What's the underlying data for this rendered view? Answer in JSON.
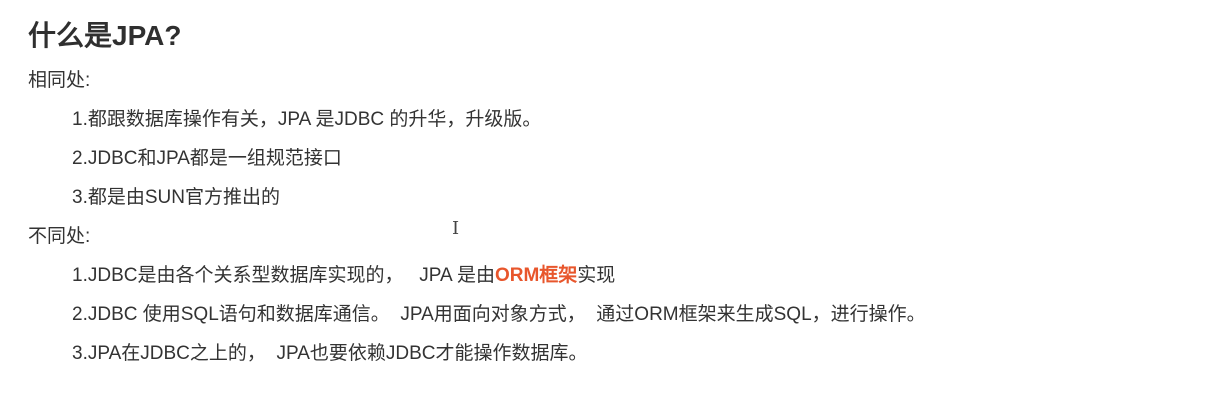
{
  "doc": {
    "title": "什么是JPA?",
    "same": {
      "heading": "相同处:",
      "items": [
        "1.都跟数据库操作有关，JPA 是JDBC 的升华，升级版。",
        "2.JDBC和JPA都是一组规范接口",
        "3.都是由SUN官方推出的"
      ]
    },
    "diff": {
      "heading": "不同处:",
      "item1": {
        "before": "1.JDBC是由各个关系型数据库实现的，   JPA 是由",
        "highlight": "ORM框架",
        "after": "实现"
      },
      "item2": "2.JDBC 使用SQL语句和数据库通信。  JPA用面向对象方式，  通过ORM框架来生成SQL，进行操作。",
      "item3": "3.JPA在JDBC之上的，  JPA也要依赖JDBC才能操作数据库。"
    }
  },
  "colors": {
    "highlight": "#e8562c",
    "text": "#333333"
  },
  "icons": {
    "cursor": "text-cursor-icon"
  }
}
